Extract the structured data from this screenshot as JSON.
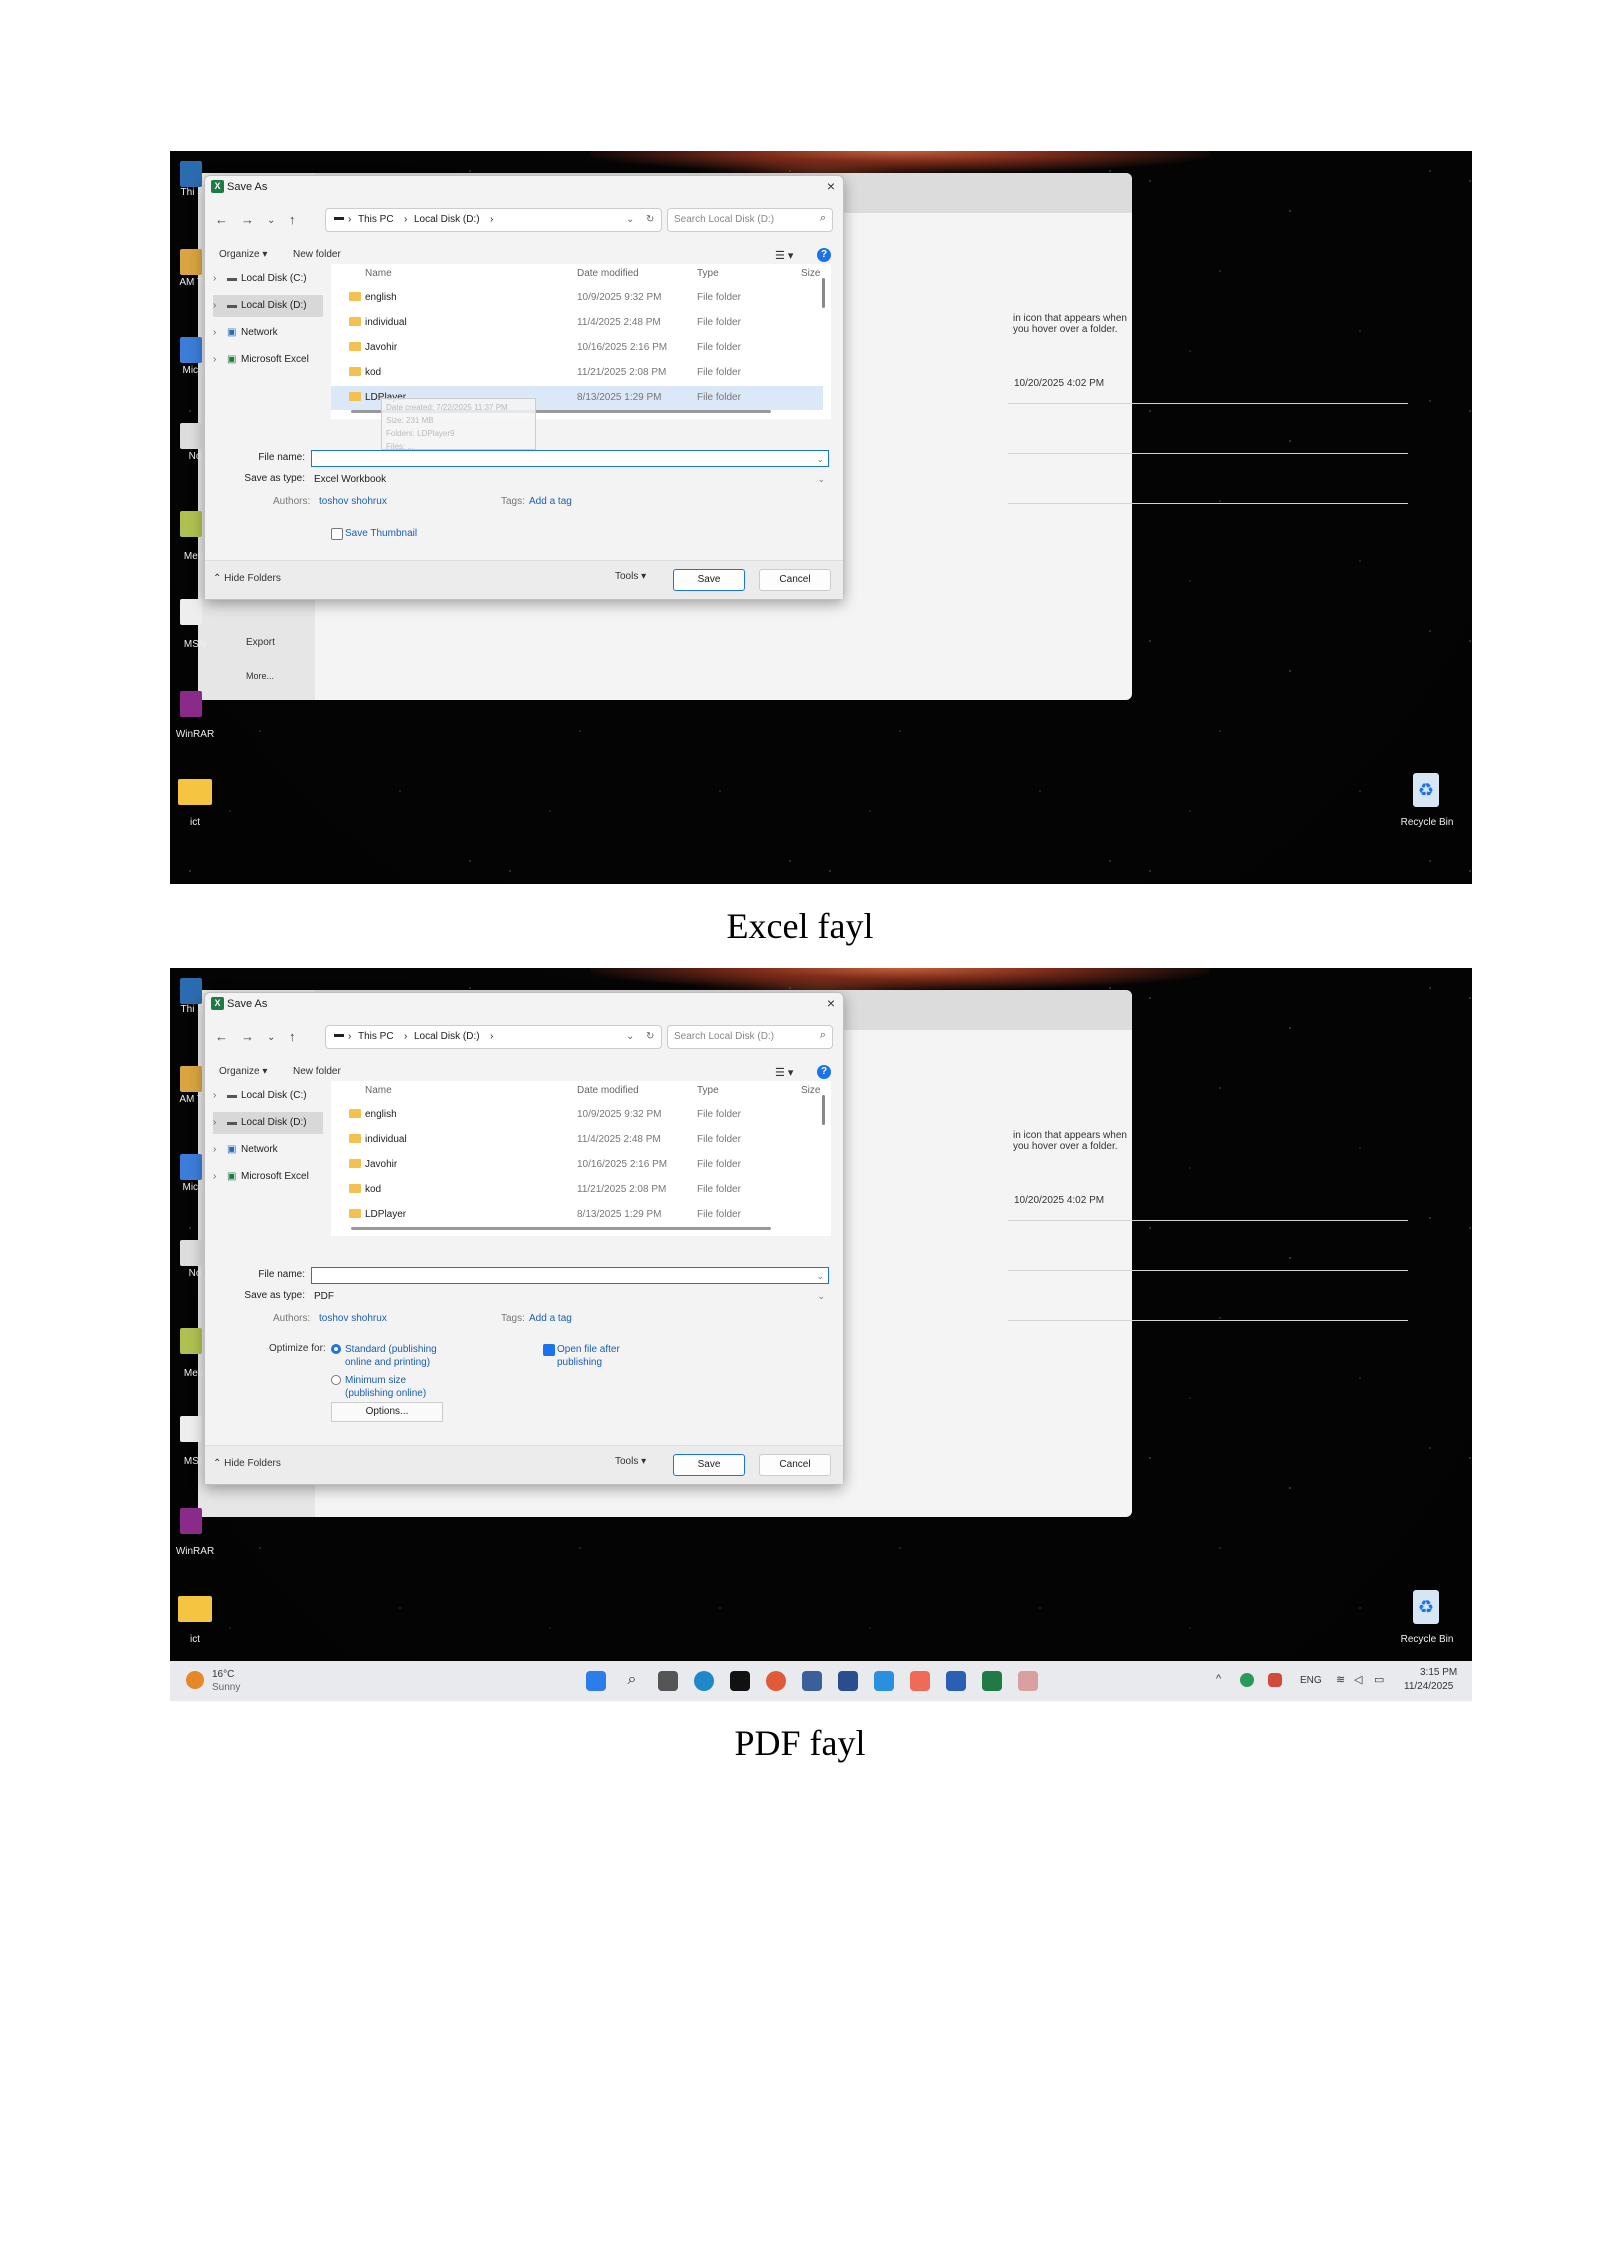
{
  "captions": [
    "Excel fayl",
    "PDF fayl"
  ],
  "desktop": {
    "icon_labels": [
      "Thi Sh",
      "AM TO",
      "Mic S",
      "No",
      "Meta",
      "MSN",
      "WinRAR",
      "ict"
    ],
    "recycle_bin": "Recycle Bin"
  },
  "background_window": {
    "hover_text": "in icon that appears when you hover over a folder.",
    "date": "10/20/2025 4:02 PM",
    "side_items": [
      "Export",
      "More..."
    ]
  },
  "dialog": {
    "title": "Save As",
    "address": {
      "root": "This PC",
      "drive": "Local Disk (D:)"
    },
    "search_placeholder": "Search Local Disk (D:)",
    "toolbar": {
      "organize": "Organize ▾",
      "new_folder": "New folder"
    },
    "tree": [
      "Local Disk (C:)",
      "Local Disk (D:)",
      "Network",
      "Microsoft Excel"
    ],
    "columns": {
      "name": "Name",
      "date": "Date modified",
      "type": "Type",
      "size": "Size"
    },
    "rows": [
      {
        "name": "english",
        "date": "10/9/2025 9:32 PM",
        "type": "File folder"
      },
      {
        "name": "individual",
        "date": "11/4/2025 2:48 PM",
        "type": "File folder"
      },
      {
        "name": "Javohir",
        "date": "10/16/2025 2:16 PM",
        "type": "File folder"
      },
      {
        "name": "kod",
        "date": "11/21/2025 2:08 PM",
        "type": "File folder"
      },
      {
        "name": "LDPlayer",
        "date": "8/13/2025 1:29 PM",
        "type": "File folder"
      }
    ],
    "tooltip": [
      "Date created: 7/22/2025 11:37 PM",
      "Size: 231 MB",
      "Folders: LDPlayer9",
      "Files: ..."
    ],
    "file_name_label": "File name:",
    "save_as_type_label": "Save as type:",
    "authors_label": "Authors:",
    "authors_value": "toshov shohrux",
    "tags_label": "Tags:",
    "tags_value": "Add a tag",
    "hide_folders": "Hide Folders",
    "tools": "Tools",
    "save": "Save",
    "cancel": "Cancel"
  },
  "excel_dialog": {
    "save_as_type": "Excel Workbook",
    "save_thumbnail": "Save Thumbnail"
  },
  "pdf_dialog": {
    "save_as_type": "PDF",
    "optimize_for": "Optimize for:",
    "option_standard": [
      "Standard (publishing",
      "online and printing)"
    ],
    "option_minimum": [
      "Minimum size",
      "(publishing online)"
    ],
    "open_after": [
      "Open file after",
      "publishing"
    ],
    "options_button": "Options..."
  },
  "taskbar": {
    "weather_temp": "16°C",
    "weather_desc": "Sunny",
    "lang": "ENG",
    "time": "3:15 PM",
    "date": "11/24/2025"
  }
}
